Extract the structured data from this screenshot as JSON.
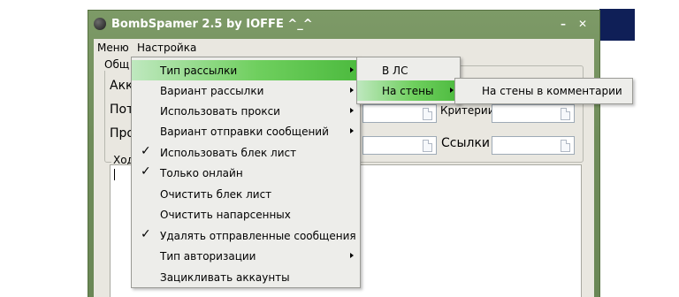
{
  "window": {
    "title": "BombSpamer 2.5 by IOFFE ^_^",
    "controls": {
      "minimize": "–",
      "close": "✕"
    }
  },
  "menubar": [
    "Меню",
    "Настройка"
  ],
  "background": {
    "group_title": "Общ",
    "account_label": "Акк",
    "threads_label": "Пот",
    "proxy_label": "Про",
    "criteria_label": "Критерии",
    "links_label": "Ссылки",
    "log_label": "Ход"
  },
  "settings_menu": {
    "items": [
      {
        "label": "Тип рассылки",
        "submenu": true,
        "checked": false,
        "selected": true
      },
      {
        "label": "Вариант рассылки",
        "submenu": true,
        "checked": false,
        "selected": false
      },
      {
        "label": "Использовать прокси",
        "submenu": true,
        "checked": false,
        "selected": false
      },
      {
        "label": "Вариант отправки сообщений",
        "submenu": true,
        "checked": false,
        "selected": false
      },
      {
        "label": "Использовать блек лист",
        "submenu": false,
        "checked": true,
        "selected": false
      },
      {
        "label": "Только онлайн",
        "submenu": false,
        "checked": true,
        "selected": false
      },
      {
        "label": "Очистить блек лист",
        "submenu": false,
        "checked": false,
        "selected": false
      },
      {
        "label": "Очистить напарсенных",
        "submenu": false,
        "checked": false,
        "selected": false
      },
      {
        "label": "Удалять отправленные сообщения",
        "submenu": false,
        "checked": true,
        "selected": false
      },
      {
        "label": "Тип авторизации",
        "submenu": true,
        "checked": false,
        "selected": false
      },
      {
        "label": "Зацикливать аккаунты",
        "submenu": false,
        "checked": false,
        "selected": false
      }
    ],
    "check_glyph": "✓"
  },
  "mailing_type_menu": {
    "items": [
      {
        "label": "В ЛС",
        "submenu": false,
        "selected": false
      },
      {
        "label": "На стены",
        "submenu": true,
        "selected": true
      }
    ]
  },
  "walls_menu": {
    "items": [
      {
        "label": "На стены в комментарии"
      }
    ]
  },
  "colors": {
    "highlight_start": "#bfe8bf",
    "highlight_end": "#4cba3e",
    "window_frame": "#6f8c5a",
    "menu_bg": "#ededea"
  }
}
